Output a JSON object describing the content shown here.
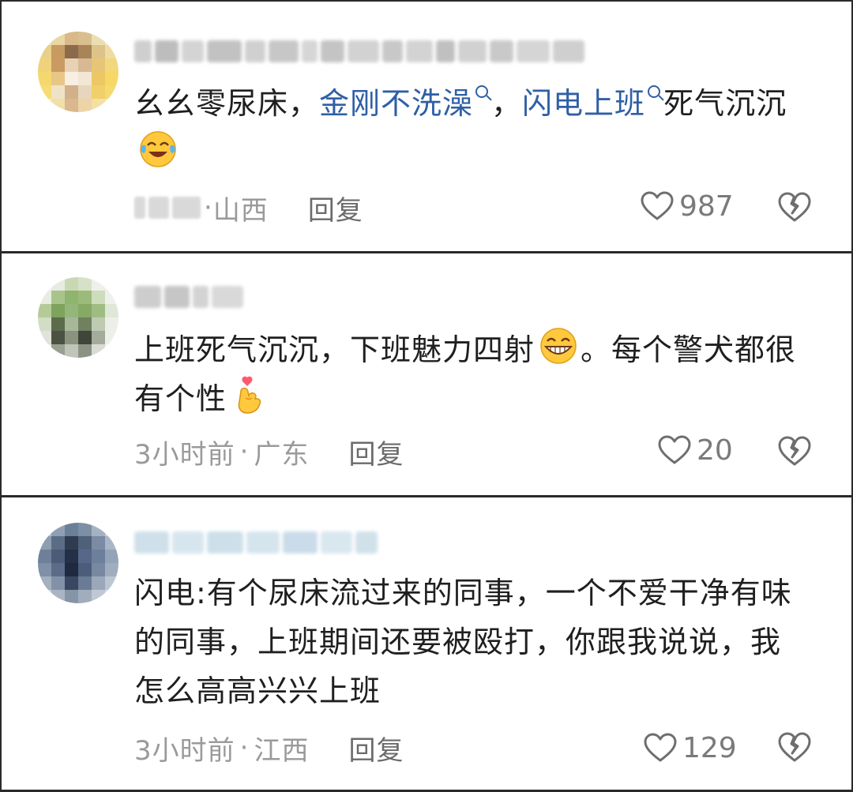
{
  "comments": [
    {
      "text_parts": {
        "before": "幺幺零尿床，",
        "link1": "金刚不洗澡",
        "mid": "，",
        "link2": "闪电上班",
        "after": "死气沉沉"
      },
      "emoji": "crying-laughing-emoji",
      "location": "山西",
      "reply": "回复",
      "likes": "987"
    },
    {
      "text": "上班死气沉沉，下班魅力四射",
      "text_tail": "。每个警犬都很有个性",
      "emoji1": "grinning-emoji",
      "emoji2": "finger-heart-emoji",
      "time": "3小时前",
      "location": "广东",
      "reply": "回复",
      "likes": "20"
    },
    {
      "text": "闪电:有个尿床流过来的同事，一个不爱干净有味的同事，上班期间还要被殴打，你跟我说说，我怎么高高兴兴上班",
      "time": "3小时前",
      "location": "江西",
      "reply": "回复",
      "likes": "129"
    }
  ],
  "colors": {
    "link": "#2f5fa6",
    "meta": "#9a9a9a",
    "border": "#2a2a2a"
  },
  "separator": "·"
}
